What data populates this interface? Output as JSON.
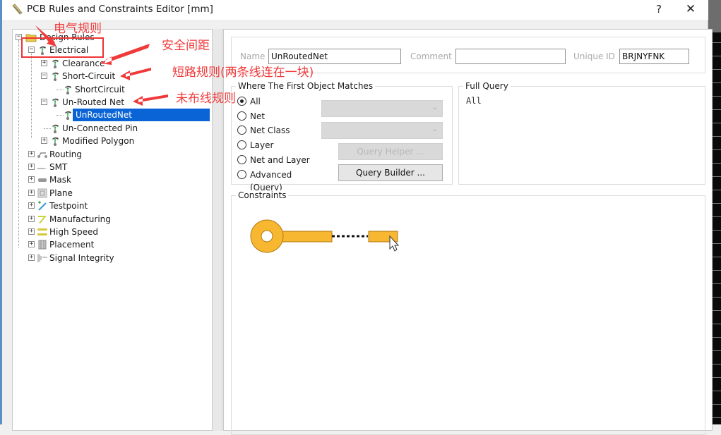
{
  "window": {
    "title": "PCB Rules and Constraints Editor [mm]",
    "help_label": "?",
    "close_label": "✕"
  },
  "tree": {
    "root": {
      "label": "Design Rules",
      "icon": "folder-icon",
      "expanded": true
    },
    "items": [
      {
        "label": "Electrical",
        "level": 1,
        "icon": "electrical-rule-icon",
        "expander": "minus"
      },
      {
        "label": "Clearance",
        "level": 2,
        "icon": "electrical-rule-icon",
        "expander": "plus"
      },
      {
        "label": "Short-Circuit",
        "level": 2,
        "icon": "electrical-rule-icon",
        "expander": "minus"
      },
      {
        "label": "ShortCircuit",
        "level": 3,
        "icon": "electrical-rule-icon",
        "expander": "none"
      },
      {
        "label": "Un-Routed Net",
        "level": 2,
        "icon": "electrical-rule-icon",
        "expander": "minus"
      },
      {
        "label": "UnRoutedNet",
        "level": 3,
        "icon": "electrical-rule-icon",
        "expander": "none",
        "selected": true
      },
      {
        "label": "Un-Connected Pin",
        "level": 2,
        "icon": "electrical-rule-icon",
        "expander": "none"
      },
      {
        "label": "Modified Polygon",
        "level": 2,
        "icon": "electrical-rule-icon",
        "expander": "plus"
      },
      {
        "label": "Routing",
        "level": 1,
        "icon": "routing-icon",
        "expander": "plus"
      },
      {
        "label": "SMT",
        "level": 1,
        "icon": "smt-icon",
        "expander": "plus"
      },
      {
        "label": "Mask",
        "level": 1,
        "icon": "mask-icon",
        "expander": "plus"
      },
      {
        "label": "Plane",
        "level": 1,
        "icon": "plane-icon",
        "expander": "plus"
      },
      {
        "label": "Testpoint",
        "level": 1,
        "icon": "testpoint-icon",
        "expander": "plus"
      },
      {
        "label": "Manufacturing",
        "level": 1,
        "icon": "manufacturing-icon",
        "expander": "plus"
      },
      {
        "label": "High Speed",
        "level": 1,
        "icon": "high-speed-icon",
        "expander": "plus"
      },
      {
        "label": "Placement",
        "level": 1,
        "icon": "placement-icon",
        "expander": "plus"
      },
      {
        "label": "Signal Integrity",
        "level": 1,
        "icon": "signal-integrity-icon",
        "expander": "plus"
      }
    ]
  },
  "rule": {
    "name_label": "Name",
    "name_value": "UnRoutedNet",
    "comment_label": "Comment",
    "comment_value": "",
    "unique_id_label": "Unique ID",
    "unique_id_value": "BRJNYFNK"
  },
  "first_object": {
    "group_label": "Where The First Object Matches",
    "options": [
      {
        "label": "All",
        "checked": true
      },
      {
        "label": "Net",
        "checked": false
      },
      {
        "label": "Net Class",
        "checked": false
      },
      {
        "label": "Layer",
        "checked": false
      },
      {
        "label": "Net and Layer",
        "checked": false
      },
      {
        "label": "Advanced (Query)",
        "checked": false
      }
    ],
    "query_helper_label": "Query Helper ...",
    "query_builder_label": "Query Builder ..."
  },
  "full_query": {
    "group_label": "Full Query",
    "text": "All"
  },
  "constraints": {
    "group_label": "Constraints",
    "colors": {
      "copper": "#f7b731",
      "outline": "#b07a10"
    }
  },
  "annotations": [
    {
      "text": "电气规则"
    },
    {
      "text": "安全间距"
    },
    {
      "text": "短路规则(两条线连在一块)"
    },
    {
      "text": "未布线规则"
    }
  ],
  "colors": {
    "selection": "#0a64d6",
    "annotation": "#f03a3a",
    "window_border": "#5a8fc8"
  }
}
